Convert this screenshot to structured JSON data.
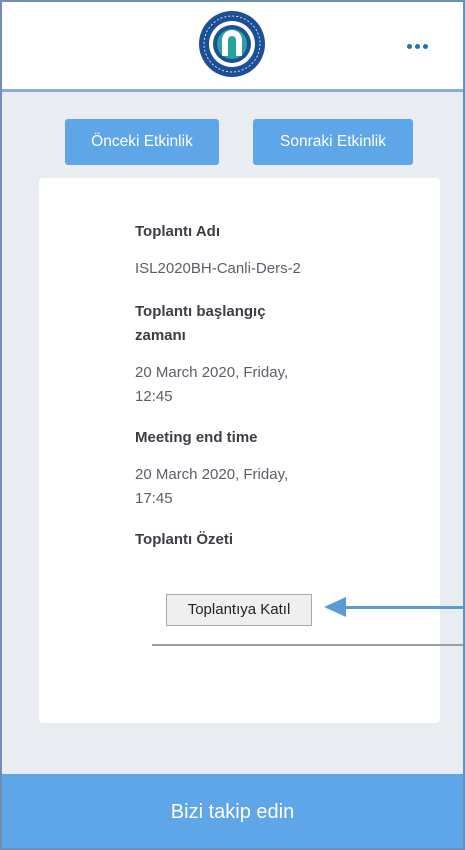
{
  "header": {
    "logo_name": "Karadeniz Teknik Üniversitesi logo",
    "menu_icon": "more-dots-icon"
  },
  "nav": {
    "prev_label": "Önceki Etkinlik",
    "next_label": "Sonraki Etkinlik"
  },
  "meeting": {
    "name_label": "Toplantı Adı",
    "name_value": "ISL2020BH-Canli-Ders-2",
    "start_label_line1": "Toplantı başlangıç",
    "start_label_line2": "zamanı",
    "start_value_line1": "20 March 2020, Friday,",
    "start_value_line2": "12:45",
    "end_label": "Meeting end time",
    "end_value_line1": "20 March 2020, Friday,",
    "end_value_line2": "17:45",
    "summary_label": "Toplantı Özeti",
    "join_label": "Toplantıya Katıl"
  },
  "footer": {
    "label": "Bizi takip edin"
  },
  "colors": {
    "accent": "#5fa6e8",
    "frame_border": "#6d8fb8",
    "arrow": "#5b9bd5"
  }
}
